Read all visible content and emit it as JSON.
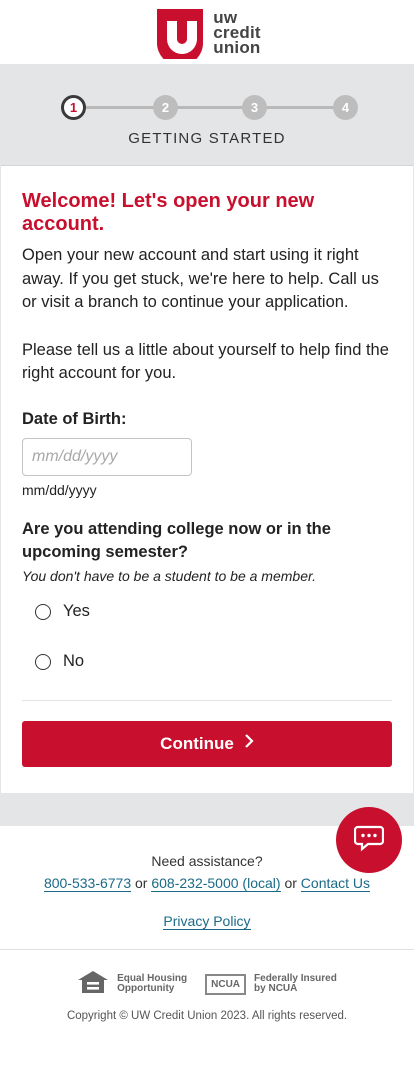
{
  "brand": {
    "logo_letter": "u",
    "name_line1": "uw",
    "name_line2": "credit",
    "name_line3": "union",
    "accent": "#c8102e"
  },
  "steps": {
    "items": [
      "1",
      "2",
      "3",
      "4"
    ],
    "current_index": 0,
    "current_label": "GETTING STARTED"
  },
  "form": {
    "headline": "Welcome! Let's open your new account.",
    "intro": "Open your new account and start using it right away. If you get stuck, we're here to help. Call us or visit a branch to continue your application.",
    "prompt": "Please tell us a little about yourself to help find the right account for you.",
    "dob_label": "Date of Birth:",
    "dob_placeholder": "mm/dd/yyyy",
    "dob_value": "",
    "dob_hint": "mm/dd/yyyy",
    "college_question": "Are you attending college now or in the upcoming semester?",
    "college_note": "You don't have to be a student to be a member.",
    "option_yes": "Yes",
    "option_no": "No",
    "continue_label": "Continue",
    "continue_icon": "chevron-right-icon"
  },
  "chat": {
    "icon": "chat-bubble-icon"
  },
  "footer": {
    "assist_title": "Need assistance?",
    "phone_primary": "800-533-6773",
    "or1": "or",
    "phone_local": "608-232-5000 (local)",
    "or2": "or",
    "contact_us": "Contact Us",
    "privacy": "Privacy Policy",
    "ehl_line1": "Equal Housing",
    "ehl_line2": "Opportunity",
    "ncua_badge": "NCUA",
    "ncua_line1": "Federally Insured",
    "ncua_line2": "by NCUA",
    "copyright": "Copyright © UW Credit Union 2023. All rights reserved."
  }
}
